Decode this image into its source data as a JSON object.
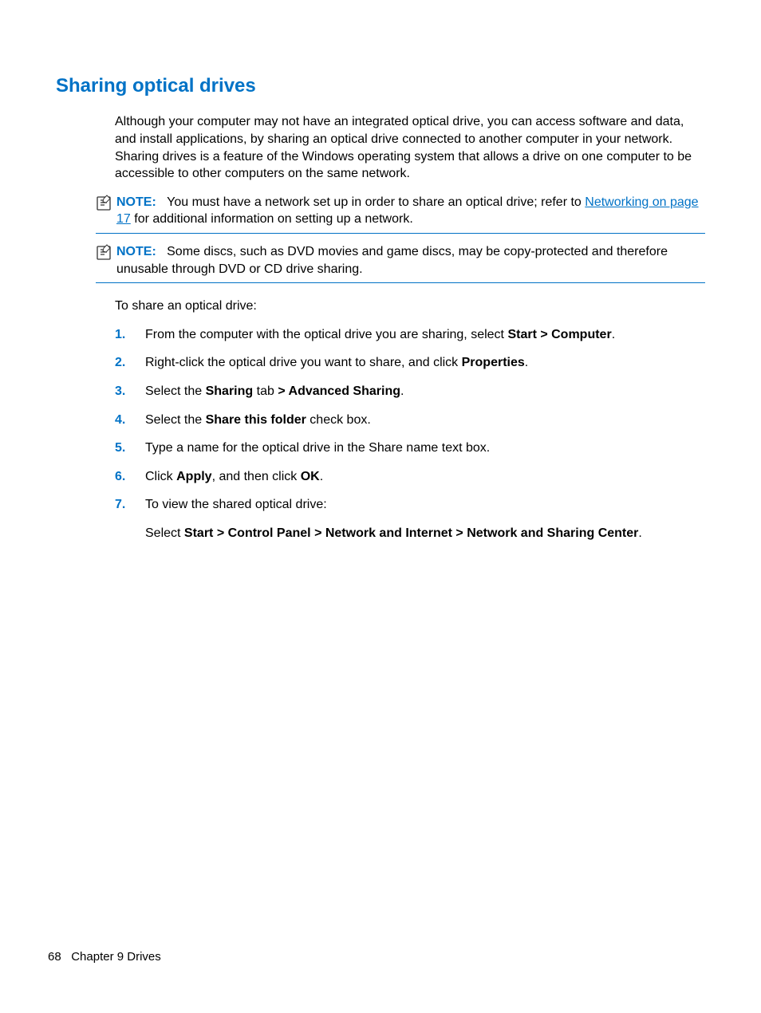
{
  "heading": "Sharing optical drives",
  "intro": "Although your computer may not have an integrated optical drive, you can access software and data, and install applications, by sharing an optical drive connected to another computer in your network. Sharing drives is a feature of the Windows operating system that allows a drive on one computer to be accessible to other computers on the same network.",
  "note_label": "NOTE:",
  "note1_pre": "You must have a network set up in order to share an optical drive; refer to ",
  "note1_link": "Networking on page 17",
  "note1_post": " for additional information on setting up a network.",
  "note2": "Some discs, such as DVD movies and game discs, may be copy-protected and therefore unusable through DVD or CD drive sharing.",
  "leadin": "To share an optical drive:",
  "steps": {
    "s1_a": "From the computer with the optical drive you are sharing, select ",
    "s1_b": "Start > Computer",
    "s1_c": ".",
    "s2_a": "Right-click the optical drive you want to share, and click ",
    "s2_b": "Properties",
    "s2_c": ".",
    "s3_a": "Select the ",
    "s3_b": "Sharing",
    "s3_c": " tab ",
    "s3_d": "> Advanced Sharing",
    "s3_e": ".",
    "s4_a": "Select the ",
    "s4_b": "Share this folder",
    "s4_c": " check box.",
    "s5": "Type a name for the optical drive in the Share name text box.",
    "s6_a": "Click ",
    "s6_b": "Apply",
    "s6_c": ", and then click ",
    "s6_d": "OK",
    "s6_e": ".",
    "s7_a": "To view the shared optical drive:",
    "s7_sub_a": "Select ",
    "s7_sub_b": "Start > Control Panel > Network and Internet > Network and Sharing Center",
    "s7_sub_c": "."
  },
  "nums": {
    "n1": "1.",
    "n2": "2.",
    "n3": "3.",
    "n4": "4.",
    "n5": "5.",
    "n6": "6.",
    "n7": "7."
  },
  "footer": {
    "page": "68",
    "chapter": "Chapter 9   Drives"
  }
}
